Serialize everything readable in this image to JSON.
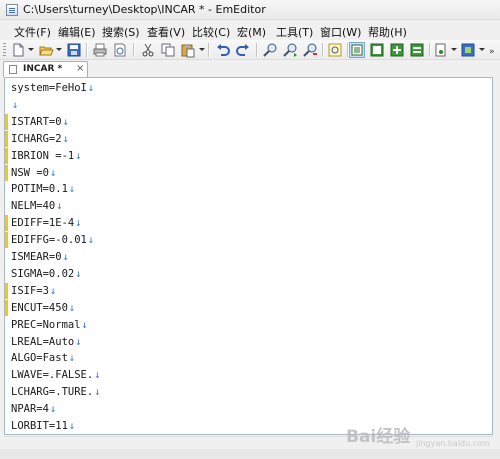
{
  "window": {
    "title": "C:\\Users\\turney\\Desktop\\INCAR * - EmEditor"
  },
  "menubar": {
    "items": [
      {
        "label": "文件(F)"
      },
      {
        "label": "编辑(E)"
      },
      {
        "label": "搜索(S)"
      },
      {
        "label": "查看(V)"
      },
      {
        "label": "比较(C)"
      },
      {
        "label": "宏(M)"
      },
      {
        "label": "工具(T)"
      },
      {
        "label": "窗口(W)"
      },
      {
        "label": "帮助(H)"
      }
    ]
  },
  "toolbar": {
    "buttons": [
      "new",
      "open",
      "save",
      "print",
      "print-preview",
      "cut",
      "copy",
      "paste",
      "undo",
      "redo",
      "find",
      "find-next",
      "replace",
      "highlight",
      "view-mode-1",
      "view-mode-2",
      "view-mode-3",
      "view-mode-4",
      "plugins",
      "macros"
    ]
  },
  "tabs": [
    {
      "label": "INCAR *",
      "close": "×"
    }
  ],
  "editor": {
    "eol_glyph": "↓",
    "lines": [
      {
        "text": "system=FeHoI",
        "marked": false
      },
      {
        "text": "",
        "marked": false
      },
      {
        "text": "ISTART=0",
        "marked": true
      },
      {
        "text": "ICHARG=2",
        "marked": true
      },
      {
        "text": "IBRION =-1",
        "marked": true
      },
      {
        "text": "NSW =0",
        "marked": true
      },
      {
        "text": "POTIM=0.1",
        "marked": false
      },
      {
        "text": "NELM=40",
        "marked": false
      },
      {
        "text": "EDIFF=1E-4",
        "marked": true
      },
      {
        "text": "EDIFFG=-0.01",
        "marked": true
      },
      {
        "text": "ISMEAR=0",
        "marked": false
      },
      {
        "text": "SIGMA=0.02",
        "marked": false
      },
      {
        "text": "ISIF=3",
        "marked": true
      },
      {
        "text": "ENCUT=450",
        "marked": true
      },
      {
        "text": "PREC=Normal",
        "marked": false
      },
      {
        "text": "LREAL=Auto",
        "marked": false
      },
      {
        "text": "ALGO=Fast",
        "marked": false
      },
      {
        "text": "LWAVE=.FALSE.",
        "marked": false
      },
      {
        "text": "LCHARG=.TURE.",
        "marked": false
      },
      {
        "text": "NPAR=4",
        "marked": false
      },
      {
        "text": "LORBIT=11",
        "marked": false
      }
    ]
  },
  "colors": {
    "marker": "#f5c518",
    "eol": "#3d7bd6"
  },
  "watermark": {
    "logo": "Bai经验",
    "sub": "jingyan.baidu.com"
  }
}
